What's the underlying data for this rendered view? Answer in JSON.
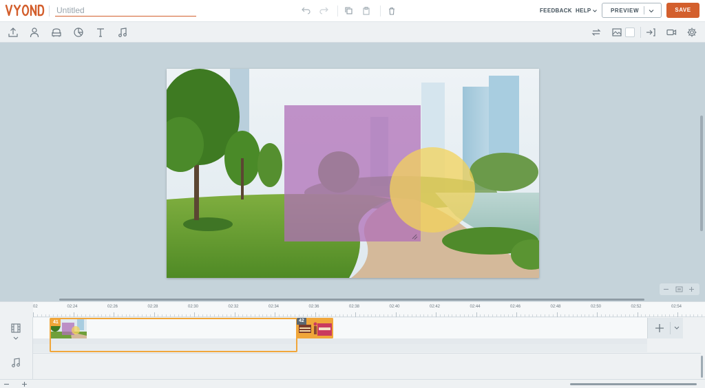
{
  "app": {
    "logo_text": "VyonD",
    "brand_color": "#d35f2d"
  },
  "project": {
    "title_value": "",
    "title_placeholder": "Untitled"
  },
  "topbar": {
    "icons": [
      "undo-icon",
      "redo-icon",
      "copy-icon",
      "paste-icon",
      "trash-icon"
    ],
    "feedback_label": "FEEDBACK",
    "help_label": "HELP",
    "preview_label": "PREVIEW",
    "save_label": "SAVE"
  },
  "toolbar": {
    "left_tools": [
      "upload-icon",
      "character-icon",
      "prop-icon",
      "chart-icon",
      "text-icon",
      "music-icon"
    ],
    "right_tools": [
      "swap-icon",
      "background-icon",
      "color-swatch",
      "enter-icon",
      "camera-icon",
      "settings-icon"
    ],
    "swatch_color": "#ffffff"
  },
  "stage": {
    "shapes": [
      {
        "name": "purple-rectangle",
        "color": "#b070b8",
        "opacity": 0.75
      },
      {
        "name": "yellow-circle",
        "color": "#f3d35b",
        "opacity": 0.75
      }
    ]
  },
  "timeline": {
    "ruler_labels": [
      "02",
      "02:24",
      "02:26",
      "02:28",
      "02:30",
      "02:32",
      "02:34",
      "02:36",
      "02:38",
      "02:40",
      "02:42",
      "02:44",
      "02:46",
      "02:48",
      "02:50",
      "02:52",
      "02:54"
    ],
    "scenes": [
      {
        "number": "41",
        "selected": true
      },
      {
        "number": "42",
        "selected": false
      }
    ],
    "selection_color": "#f0a63a"
  }
}
